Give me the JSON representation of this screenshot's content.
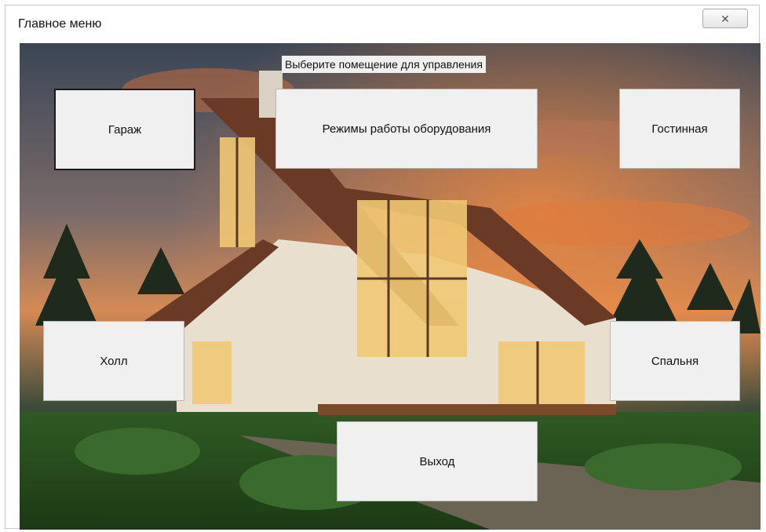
{
  "window": {
    "title": "Главное меню",
    "close_glyph": "✕"
  },
  "main": {
    "prompt": "Выберите помещение для управления",
    "buttons": {
      "garage": "Гараж",
      "modes": "Режимы работы оборудования",
      "living_room": "Гостинная",
      "hall": "Холл",
      "bedroom": "Спальня",
      "exit": "Выход"
    }
  },
  "colors": {
    "button_face": "#f0f0f0",
    "sky_top": "#3a4a5c",
    "sunset": "#e0783a"
  }
}
